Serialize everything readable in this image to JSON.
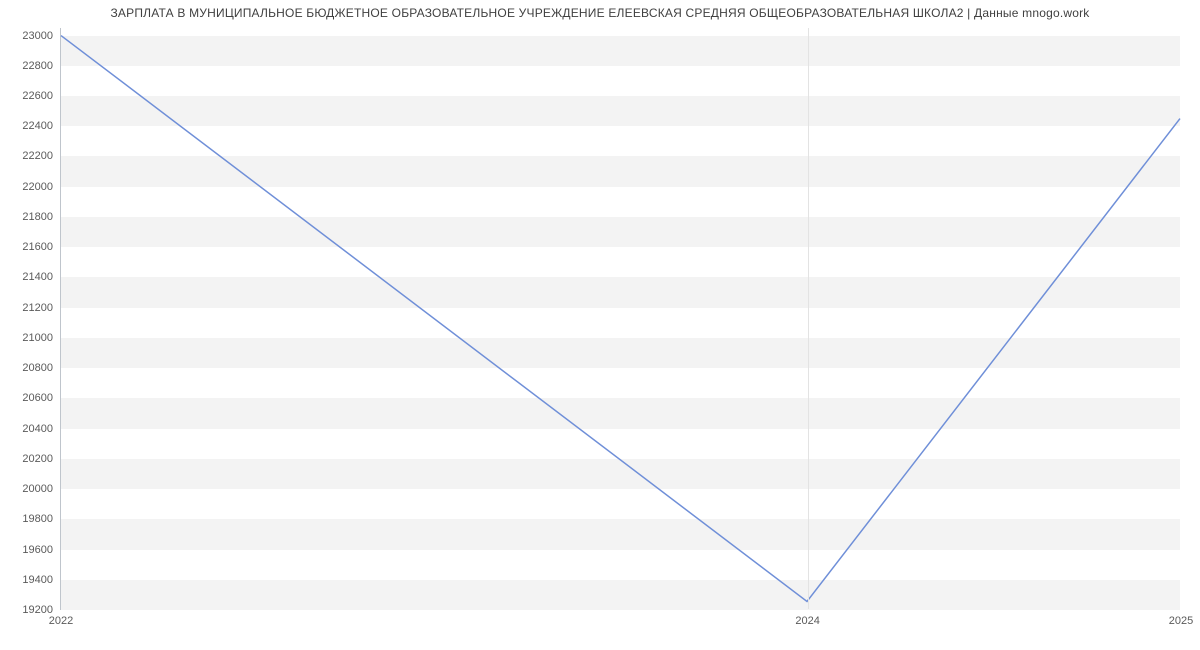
{
  "chart_data": {
    "type": "line",
    "title": "ЗАРПЛАТА В МУНИЦИПАЛЬНОЕ БЮДЖЕТНОЕ ОБРАЗОВАТЕЛЬНОЕ УЧРЕЖДЕНИЕ ЕЛЕЕВСКАЯ СРЕДНЯЯ ОБЩЕОБРАЗОВАТЕЛЬНАЯ ШКОЛА2 | Данные mnogo.work",
    "xlabel": "",
    "ylabel": "",
    "x": [
      2022,
      2024,
      2025
    ],
    "values": [
      23000,
      19250,
      22450
    ],
    "y_ticks": [
      19200,
      19400,
      19600,
      19800,
      20000,
      20200,
      20400,
      20600,
      20800,
      21000,
      21200,
      21400,
      21600,
      21800,
      22000,
      22200,
      22400,
      22600,
      22800,
      23000
    ],
    "x_ticks": [
      2022,
      2024,
      2025
    ],
    "xlim": [
      2022,
      2025
    ],
    "ylim": [
      19200,
      23050
    ],
    "grid": true,
    "line_color": "#6f8fd8"
  }
}
